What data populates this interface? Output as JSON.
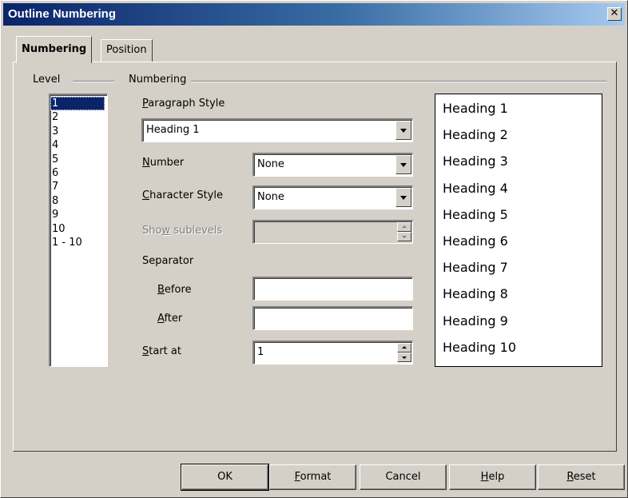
{
  "window": {
    "title": "Outline Numbering",
    "close_glyph": "✕"
  },
  "tabs": [
    {
      "label": "Numbering",
      "active": true
    },
    {
      "label": "Position",
      "active": false
    }
  ],
  "level_section": {
    "label": "Level",
    "items": [
      "1",
      "2",
      "3",
      "4",
      "5",
      "6",
      "7",
      "8",
      "9",
      "10",
      "1 - 10"
    ],
    "selected": "1"
  },
  "numbering_section": {
    "label": "Numbering",
    "paragraph_style": {
      "label_pre": "",
      "label_ul": "P",
      "label_post": "aragraph Style",
      "value": "Heading 1"
    },
    "number": {
      "label_ul": "N",
      "label_post": "umber",
      "value": "None"
    },
    "character_style": {
      "label_ul": "C",
      "label_post": "haracter Style",
      "value": "None"
    },
    "show_sublevels": {
      "label_pre": "Sho",
      "label_ul": "w",
      "label_post": " sublevels",
      "value": ""
    },
    "separator": {
      "label": "Separator",
      "before": {
        "label_ul": "B",
        "label_post": "efore",
        "value": ""
      },
      "after": {
        "label_ul": "A",
        "label_post": "fter",
        "value": ""
      }
    },
    "start_at": {
      "label_ul": "S",
      "label_post": "tart at",
      "value": "1"
    }
  },
  "preview": {
    "items": [
      "Heading 1",
      "Heading 2",
      "Heading 3",
      "Heading 4",
      "Heading 5",
      "Heading 6",
      "Heading 7",
      "Heading 8",
      "Heading 9",
      "Heading 10"
    ]
  },
  "buttons": {
    "ok": {
      "label": "OK"
    },
    "format": {
      "label_ul": "F",
      "label_post": "ormat"
    },
    "cancel": {
      "label": "Cancel"
    },
    "help": {
      "label_ul": "H",
      "label_post": "elp"
    },
    "reset": {
      "label_ul": "R",
      "label_post": "eset"
    }
  },
  "colors": {
    "titlebar_start": "#0a246a",
    "titlebar_end": "#a6caf0",
    "selection": "#0a246a",
    "face": "#d4d0c8"
  }
}
